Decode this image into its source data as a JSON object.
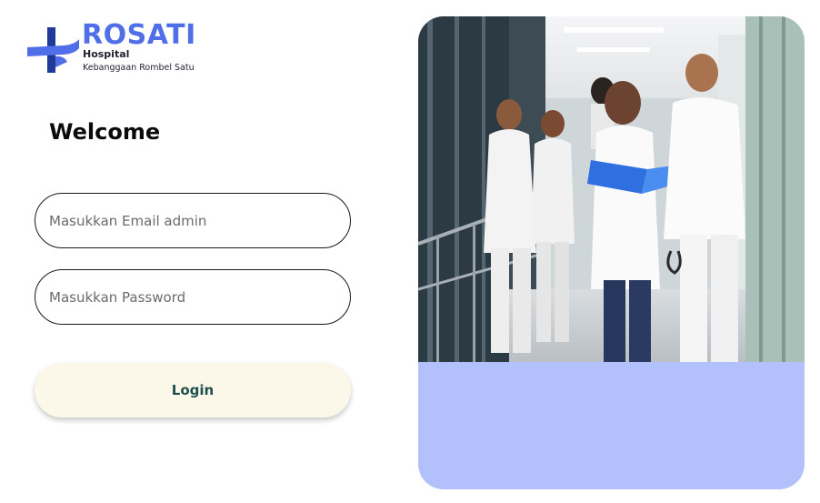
{
  "brand": {
    "name": "ROSATI",
    "subtitle": "Hospital",
    "tagline": "Kebanggaan Rombel Satu",
    "logo_icon": "medical-cross-icon",
    "primary_color": "#4f6ee8",
    "secondary_color": "#1f3a99"
  },
  "login_form": {
    "heading": "Welcome",
    "email_placeholder": "Masukkan Email admin",
    "email_value": "",
    "password_placeholder": "Masukkan Password",
    "password_value": "",
    "submit_label": "Login",
    "submit_bg_color": "#fbf8ea",
    "submit_text_color": "#1f4f4c"
  },
  "hero": {
    "image_subject": "medical-staff-walking-in-hospital-corridor",
    "panel_color": "#b2c1fb"
  }
}
